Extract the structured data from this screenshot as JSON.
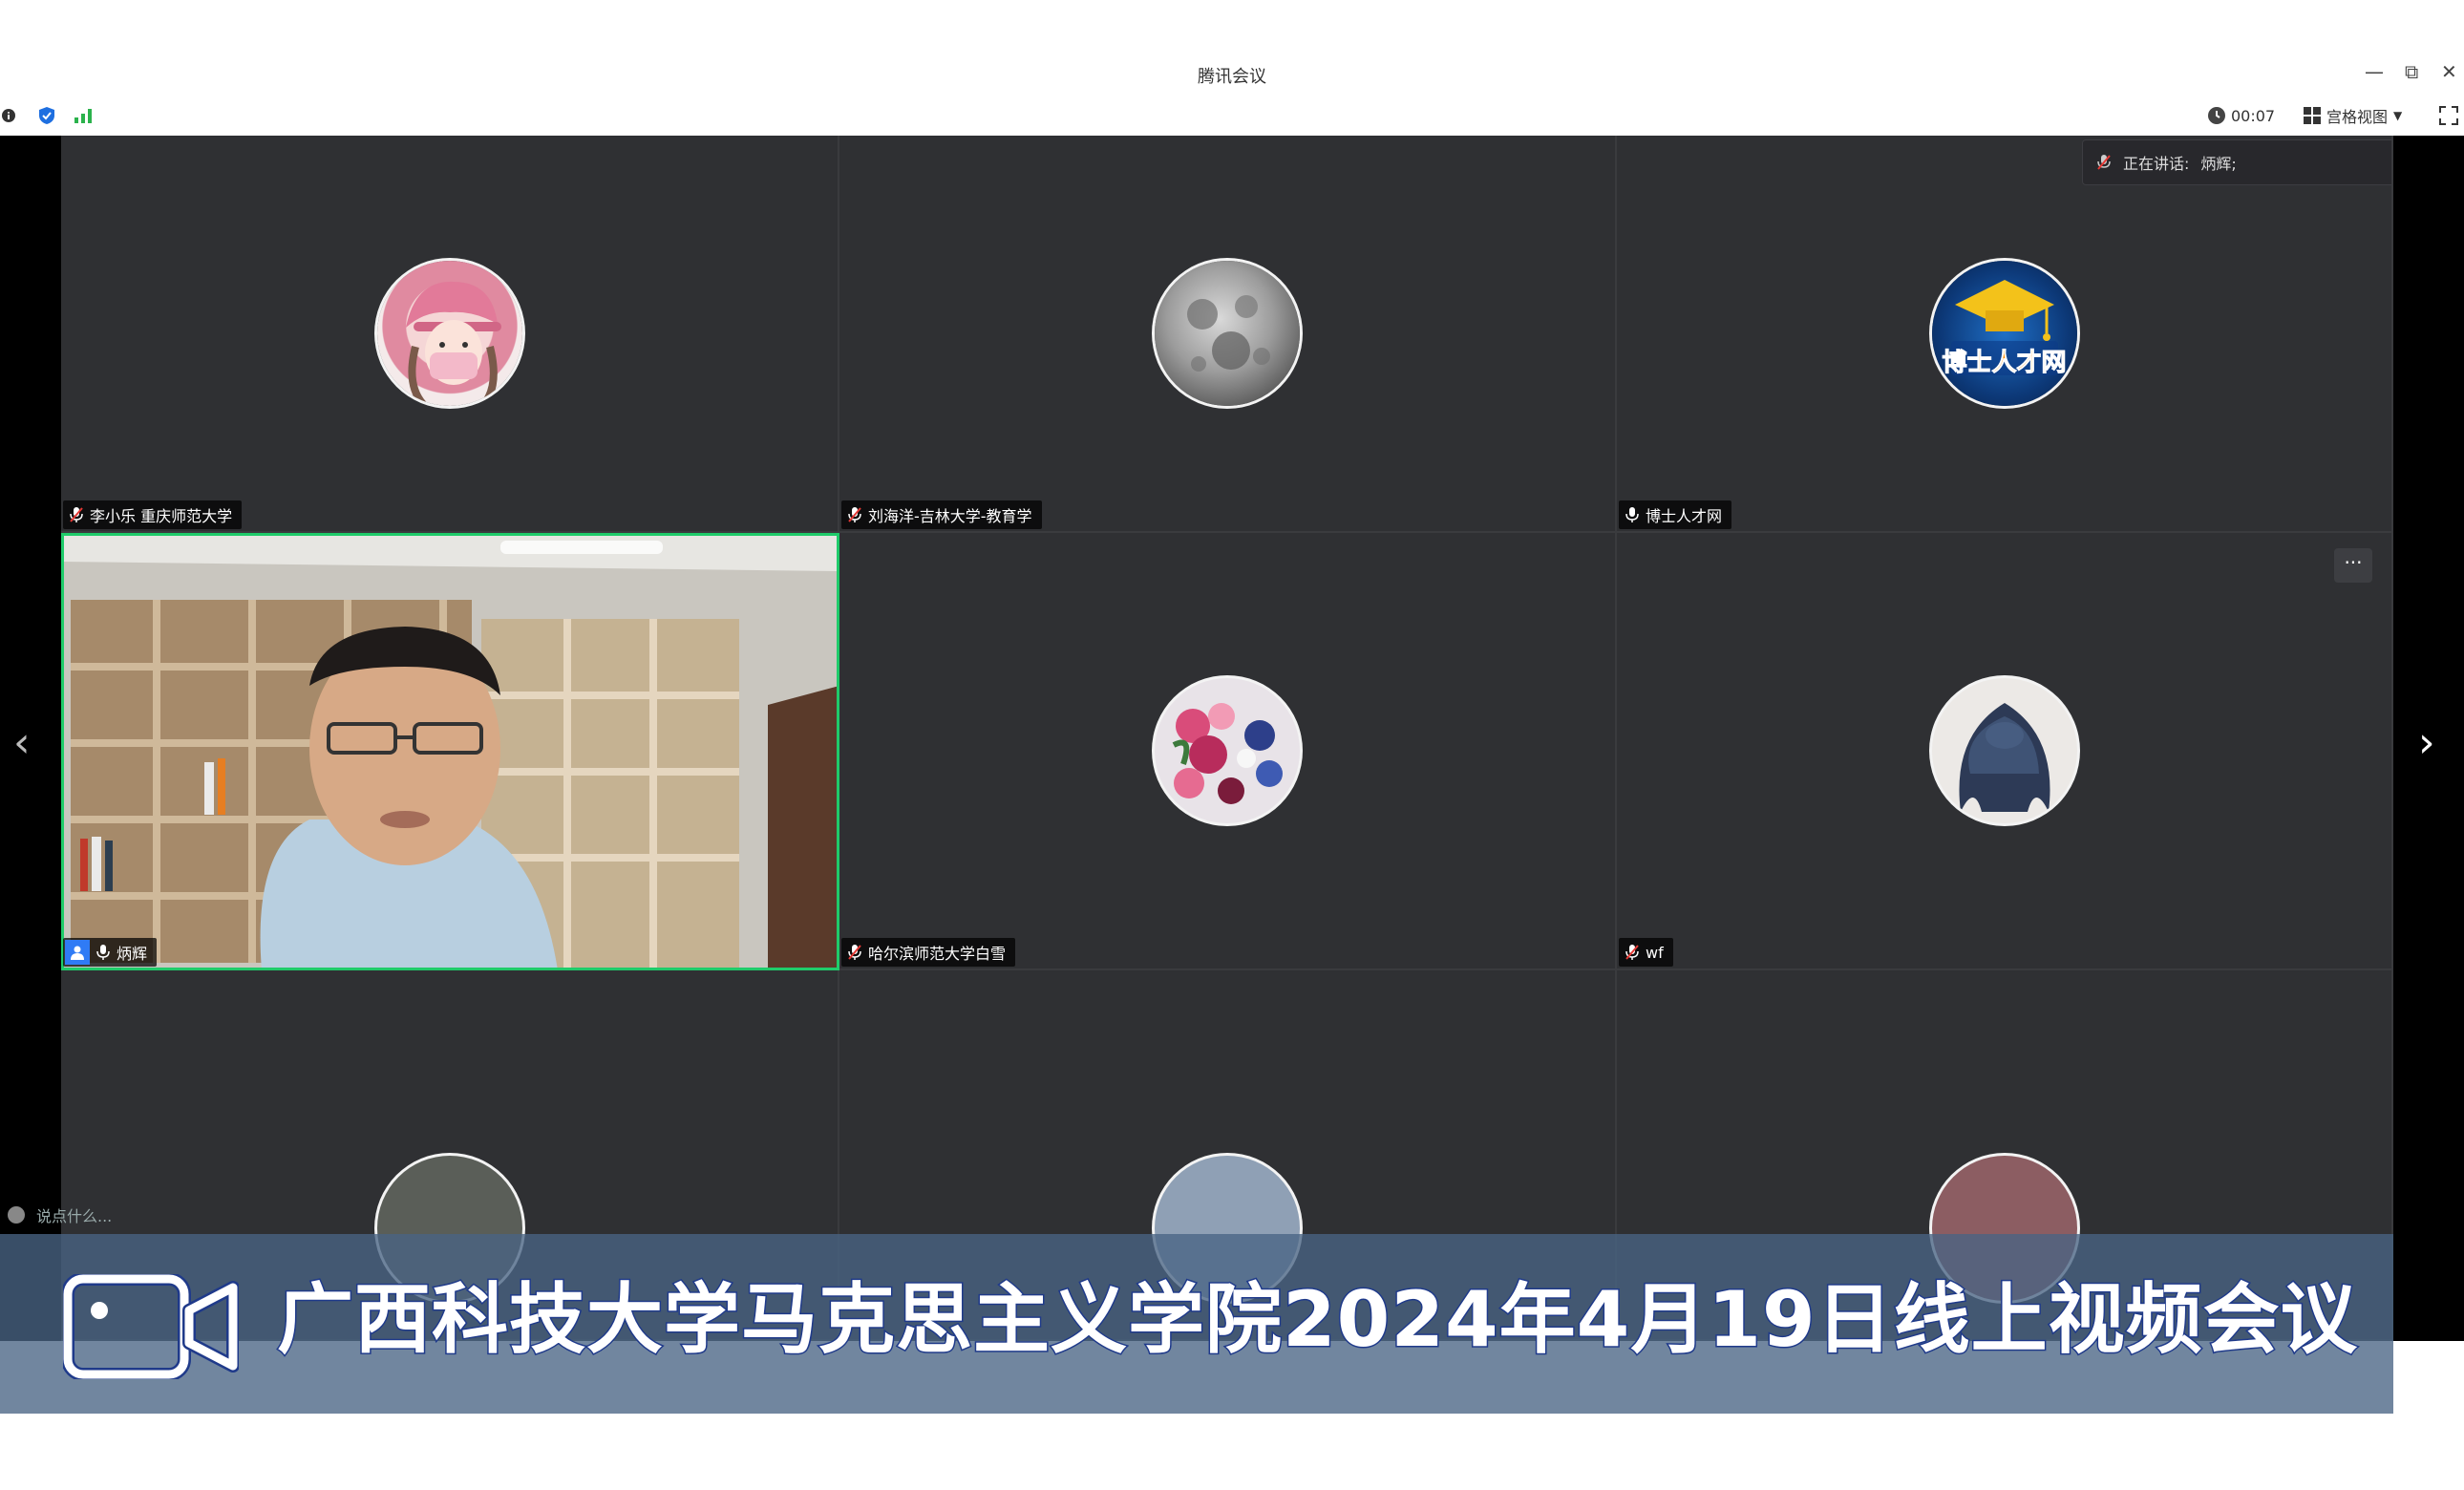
{
  "window": {
    "title": "腾讯会议",
    "controls": {
      "minimize": "—",
      "restore": "⧉",
      "close": "✕"
    }
  },
  "toolbar": {
    "timer": "00:07",
    "view_mode": "宫格视图",
    "icons": [
      "info-icon",
      "shield-icon",
      "signal-icon",
      "clock-icon",
      "grid-view-icon",
      "fullscreen-icon"
    ]
  },
  "speaking": {
    "label": "正在讲话:",
    "name": "炳辉;"
  },
  "participants": [
    {
      "name": "李小乐 重庆师范大学",
      "mic": "muted",
      "avatar": "girl-with-pink-cap"
    },
    {
      "name": "刘海洋-吉林大学-教育学",
      "mic": "muted",
      "avatar": "full-moon"
    },
    {
      "name": "博士人才网",
      "mic": "on",
      "avatar": "博士人才网 logo"
    },
    {
      "name": "炳辉",
      "mic": "on",
      "video": "on",
      "host": true
    },
    {
      "name": "哈尔滨师范大学白雪",
      "mic": "muted",
      "avatar": "flowers"
    },
    {
      "name": "wf",
      "mic": "muted",
      "avatar": "blue-hair"
    }
  ],
  "avatar_text": {
    "boshi_logo": "博士人才网"
  },
  "banner": {
    "text": "广西科技大学马克思主义学院2024年4月19日线上视频会议"
  },
  "chat": {
    "placeholder": "说点什么..."
  },
  "colors": {
    "active_border": "#1fcb6a",
    "stage_bg": "#2f3033",
    "banner_bg": "#496484",
    "banner_text_stroke": "#1f3a8a"
  }
}
